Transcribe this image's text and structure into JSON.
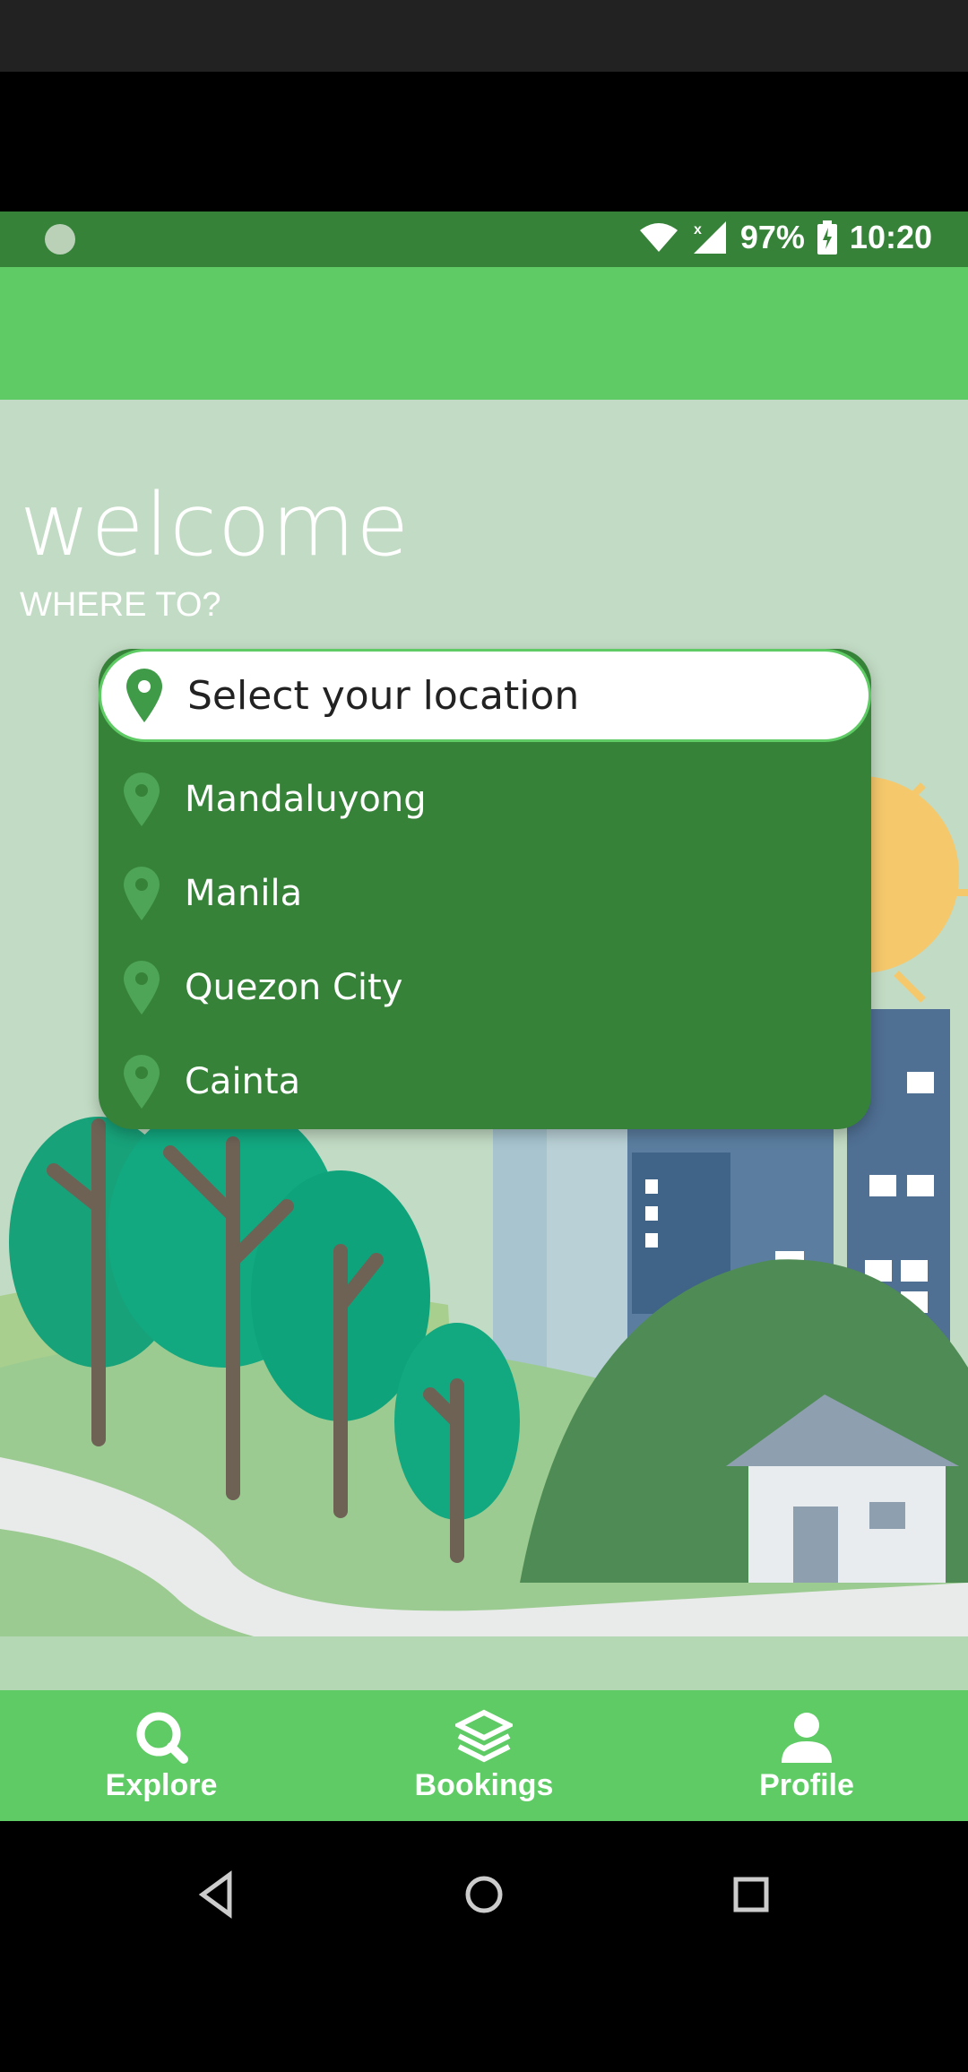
{
  "status_bar": {
    "battery": "97%",
    "time": "10:20"
  },
  "hero": {
    "title": "welcome",
    "subtitle": "WHERE TO?"
  },
  "location_select": {
    "placeholder": "Select your location",
    "options": [
      "Mandaluyong",
      "Manila",
      "Quezon City",
      "Cainta"
    ]
  },
  "bottom_nav": {
    "items": [
      {
        "label": "Explore",
        "icon": "search-icon"
      },
      {
        "label": "Bookings",
        "icon": "bookings-icon"
      },
      {
        "label": "Profile",
        "icon": "profile-icon"
      }
    ]
  },
  "colors": {
    "primary": "#5ecb64",
    "dark_green": "#358238",
    "background": "#c2dbc4"
  }
}
